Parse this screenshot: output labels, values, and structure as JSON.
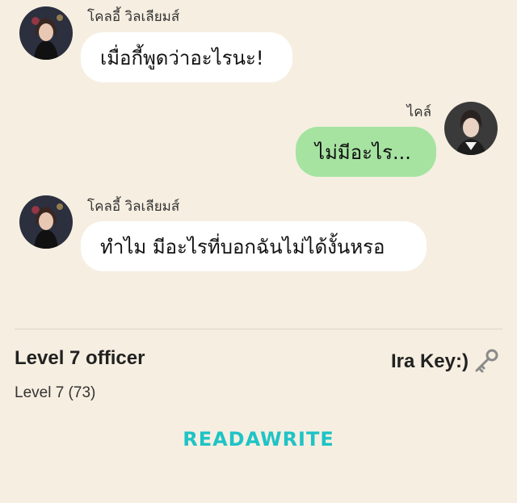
{
  "messages": [
    {
      "sender": "โคลอี้ วิลเลียมส์",
      "text": "เมื่อกี้พูดว่าอะไรนะ!"
    },
    {
      "sender": "ไคล์",
      "text": "ไม่มีอะไร..."
    },
    {
      "sender": "โคลอี้ วิลเลียมส์",
      "text": "ทำไม มีอะไรที่บอกฉันไม่ได้งั้นหรอ"
    }
  ],
  "footer": {
    "title": "Level 7 officer",
    "level": "Level 7 (73)",
    "author": "Ira Key:)",
    "logo": "READAWRITE"
  },
  "colors": {
    "background": "#f6efe1",
    "left_bubble": "#ffffff",
    "right_bubble": "#a6e3a1",
    "logo": "#1fc3c6"
  },
  "icons": {
    "author_icon": "key-icon"
  }
}
